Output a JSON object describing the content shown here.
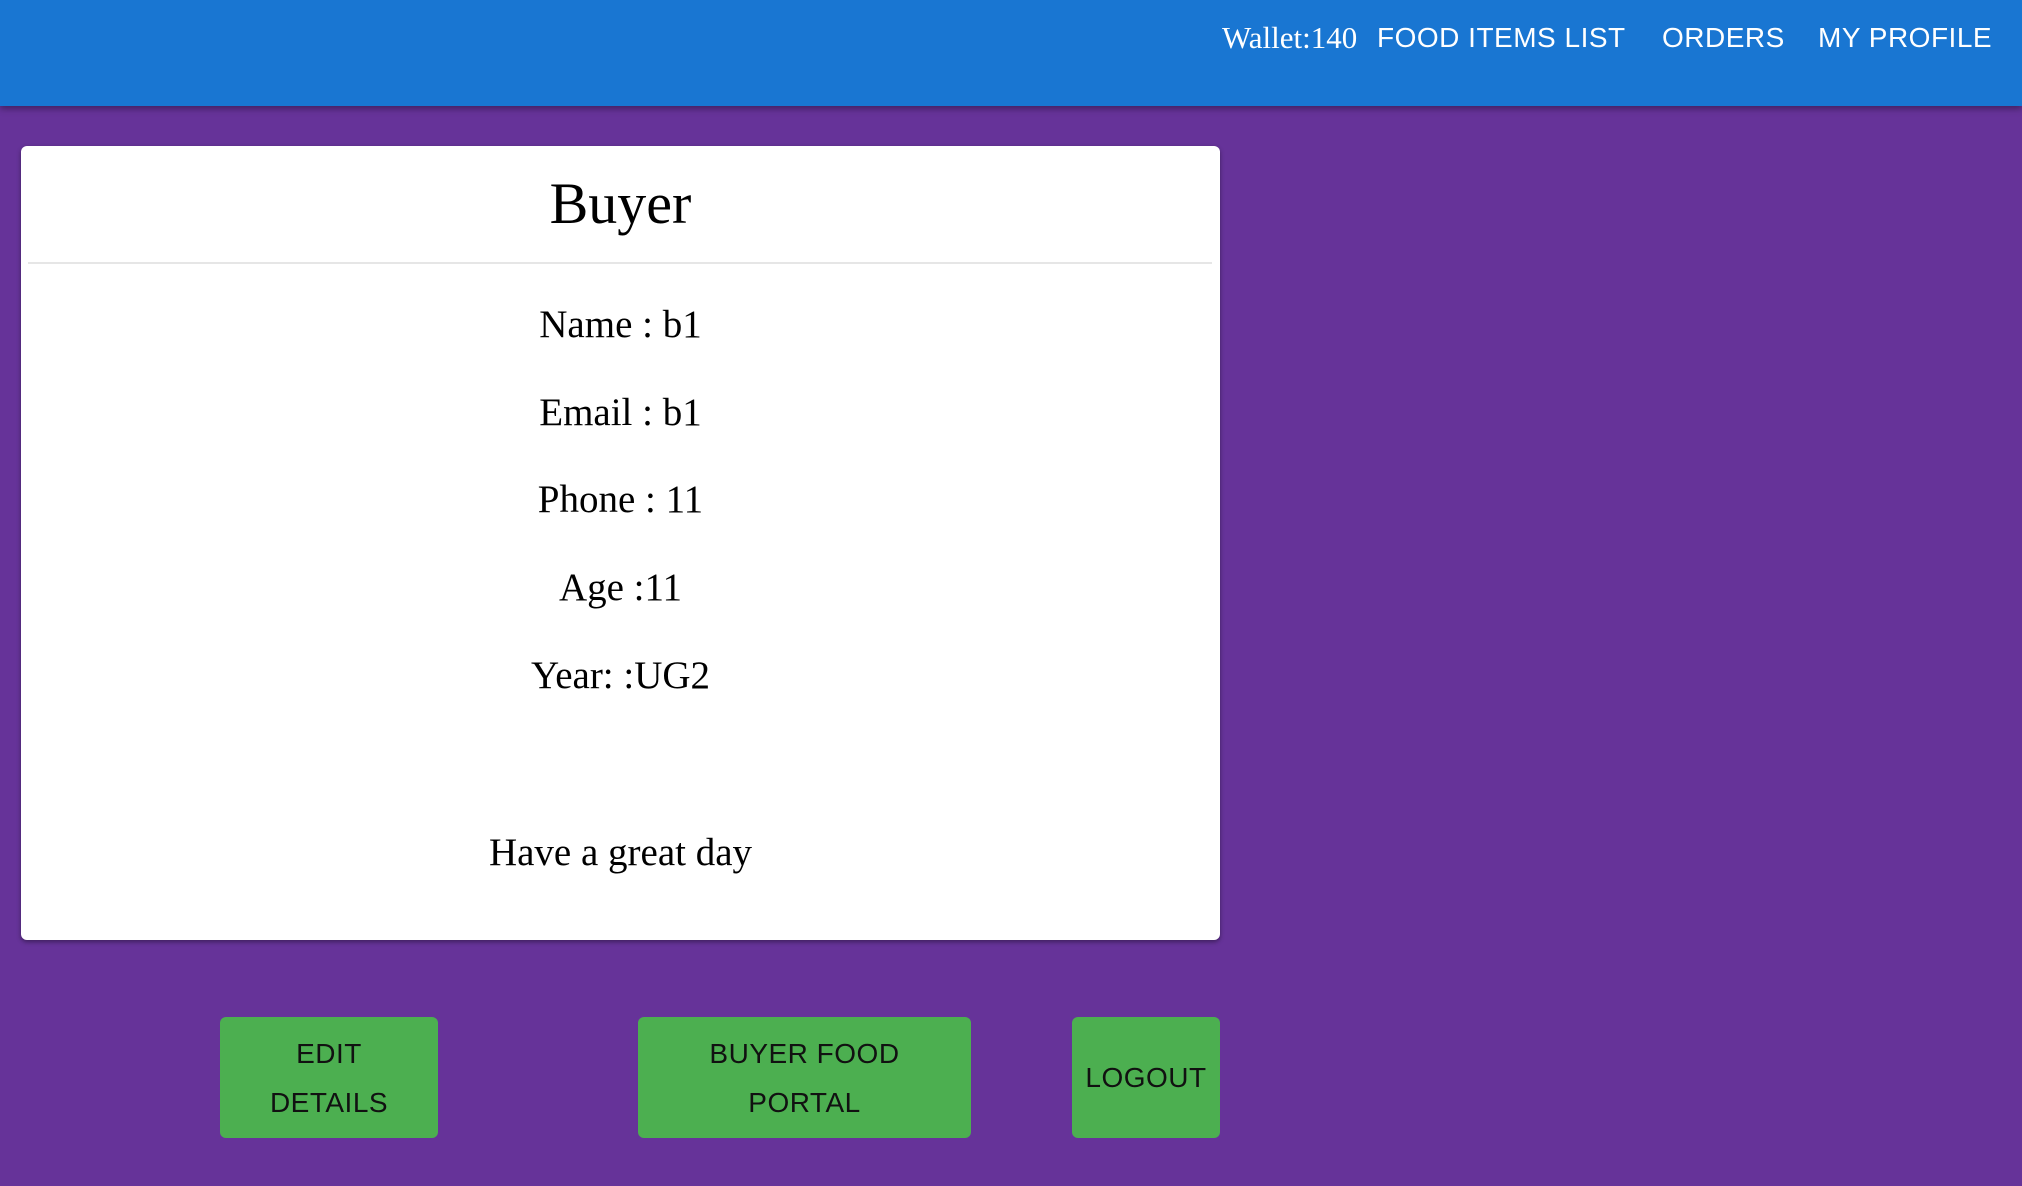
{
  "header": {
    "wallet": "Wallet:140",
    "nav": [
      "FOOD ITEMS LIST",
      "ORDERS",
      "MY PROFILE"
    ]
  },
  "profile": {
    "title": "Buyer",
    "name": "Name : b1",
    "email": "Email : b1",
    "phone": "Phone : 11",
    "age": "Age :11",
    "year": "Year: :UG2",
    "greeting": "Have a great day"
  },
  "buttons": {
    "edit": [
      "EDIT",
      "DETAILS"
    ],
    "portal": [
      "BUYER FOOD",
      "PORTAL"
    ],
    "logout": "LOGOUT"
  },
  "colors": {
    "appbar": "#1976d2",
    "background": "#663399",
    "button": "#4caf50"
  }
}
